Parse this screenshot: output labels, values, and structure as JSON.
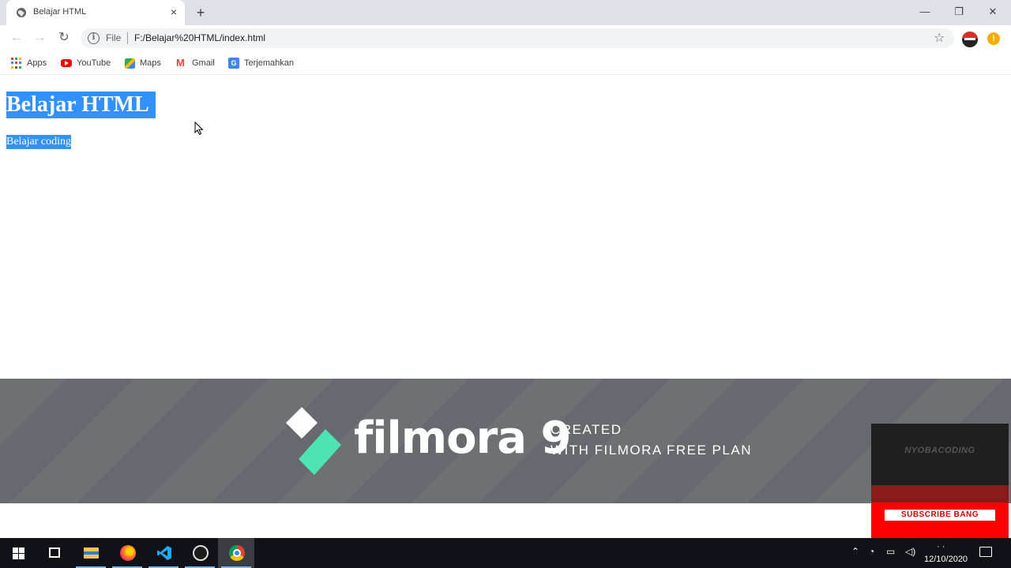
{
  "browser": {
    "tab": {
      "title": "Belajar HTML",
      "close": "×"
    },
    "new_tab": "+",
    "window_controls": {
      "minimize": "—",
      "restore": "❐",
      "close": "✕"
    },
    "nav": {
      "back": "←",
      "forward": "→",
      "reload": "↻"
    },
    "omnibox": {
      "scheme_label": "File",
      "url": "F:/Belajar%20HTML/index.html",
      "info_icon": "i",
      "bookmark_icon": "☆"
    },
    "alert_badge": "!",
    "bookmarks": [
      {
        "label": "Apps",
        "icon": "apps-grid-icon"
      },
      {
        "label": "YouTube",
        "icon": "youtube-icon"
      },
      {
        "label": "Maps",
        "icon": "maps-icon"
      },
      {
        "label": "Gmail",
        "icon": "gmail-icon"
      },
      {
        "label": "Terjemahkan",
        "icon": "translate-icon"
      }
    ],
    "translate_glyph": "G"
  },
  "page": {
    "heading": "Belajar HTML",
    "paragraph": "Belajar coding",
    "selection_color": "#3390ff"
  },
  "watermark": {
    "brand": "filmora 9",
    "line1": "CREATED",
    "line2": "WITH FILMORA FREE PLAN"
  },
  "overlay": {
    "channel": "NYOBACODING",
    "subscribe": "SUBSCRIBE BANG"
  },
  "taskbar": {
    "date": "12/10/2020",
    "time": "· ·"
  },
  "colors": {
    "accent": "#3390ff",
    "taskbar": "#101217",
    "watermark_bg": "#686c70",
    "subscribe_red": "#ff0000"
  }
}
